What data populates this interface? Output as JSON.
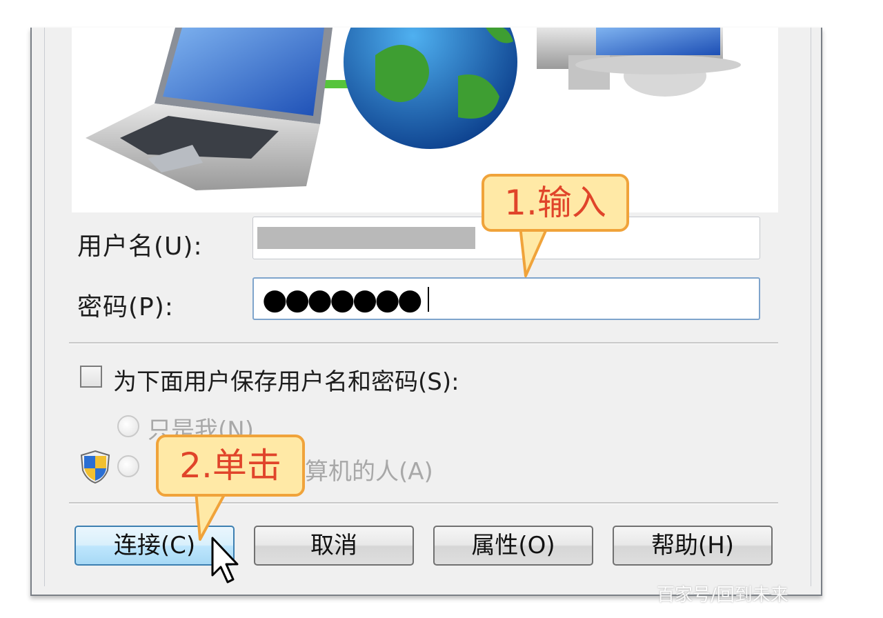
{
  "form": {
    "username_label": "用户名(U):",
    "password_label": "密码(P):",
    "password_mask": "●●●●●●●",
    "save_checkbox_label": "为下面用户保存用户名和密码(S):",
    "radio_me_only": "只是我(N)",
    "radio_anyone_suffix": "算机的人(A)"
  },
  "buttons": {
    "connect": "连接(C)",
    "cancel": "取消",
    "properties": "属性(O)",
    "help": "帮助(H)"
  },
  "annotations": {
    "step1": "1.输入",
    "step2": "2.单击"
  },
  "watermark": "百家号/回到未来",
  "icons": [
    "laptop-icon",
    "globe-icon",
    "monitor-icon",
    "shield-icon",
    "cursor-icon"
  ],
  "colors": {
    "callout_fill": "#ffe9a6",
    "callout_border": "#f0a33a",
    "callout_text": "#e0442a",
    "primary_button": "#bee6fd"
  }
}
